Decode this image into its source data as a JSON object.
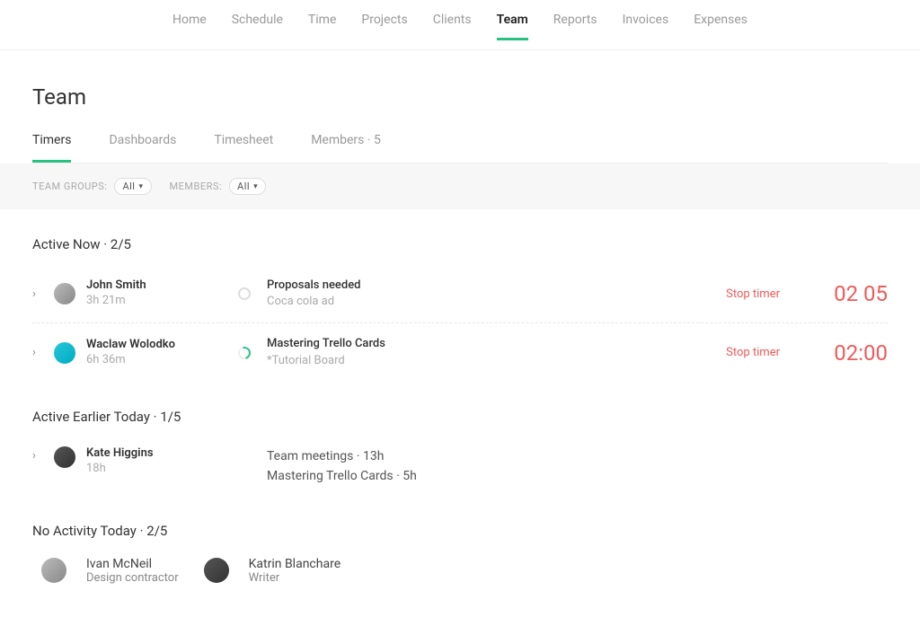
{
  "nav": {
    "items": [
      "Home",
      "Schedule",
      "Time",
      "Projects",
      "Clients",
      "Team",
      "Reports",
      "Invoices",
      "Expenses"
    ],
    "active": "Team"
  },
  "page": {
    "title": "Team"
  },
  "subtabs": {
    "items": [
      "Timers",
      "Dashboards",
      "Timesheet",
      "Members · 5"
    ],
    "active": "Timers"
  },
  "filters": {
    "groups_label": "TEAM GROUPS:",
    "members_label": "MEMBERS:",
    "all": "All"
  },
  "sections": {
    "active_now": {
      "title": "Active Now · 2/5",
      "rows": [
        {
          "name": "John Smith",
          "duration": "3h 21m",
          "task": "Proposals needed",
          "project": "Coca cola ad",
          "stop": "Stop timer",
          "timer": "02 05",
          "running": false
        },
        {
          "name": "Waclaw Wolodko",
          "duration": "6h 36m",
          "task": "Mastering Trello Cards",
          "project": "*Tutorial Board",
          "stop": "Stop timer",
          "timer": "02:00",
          "running": true
        }
      ]
    },
    "earlier": {
      "title": "Active Earlier Today · 1/5",
      "rows": [
        {
          "name": "Kate Higgins",
          "duration": "18h",
          "tasks": [
            "Team meetings · 13h",
            "Mastering Trello Cards · 5h"
          ]
        }
      ]
    },
    "no_activity": {
      "title": "No Activity Today · 2/5",
      "people": [
        {
          "name": "Ivan McNeil",
          "role": "Design contractor"
        },
        {
          "name": "Katrin Blanchare",
          "role": "Writer"
        }
      ]
    }
  }
}
